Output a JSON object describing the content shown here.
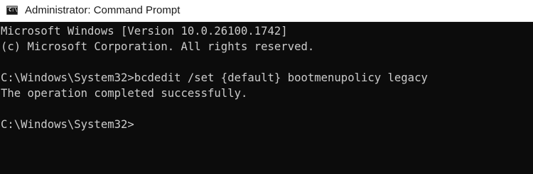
{
  "window": {
    "title": "Administrator: Command Prompt",
    "icon": "command-prompt-icon",
    "icon_glyph": "C:\\"
  },
  "console": {
    "lines": [
      "Microsoft Windows [Version 10.0.26100.1742]",
      "(c) Microsoft Corporation. All rights reserved.",
      "",
      "C:\\Windows\\System32>bcdedit /set {default} bootmenupolicy legacy",
      "The operation completed successfully.",
      "",
      "C:\\Windows\\System32>"
    ],
    "text_color": "#cccccc",
    "background_color": "#0c0c0c"
  }
}
